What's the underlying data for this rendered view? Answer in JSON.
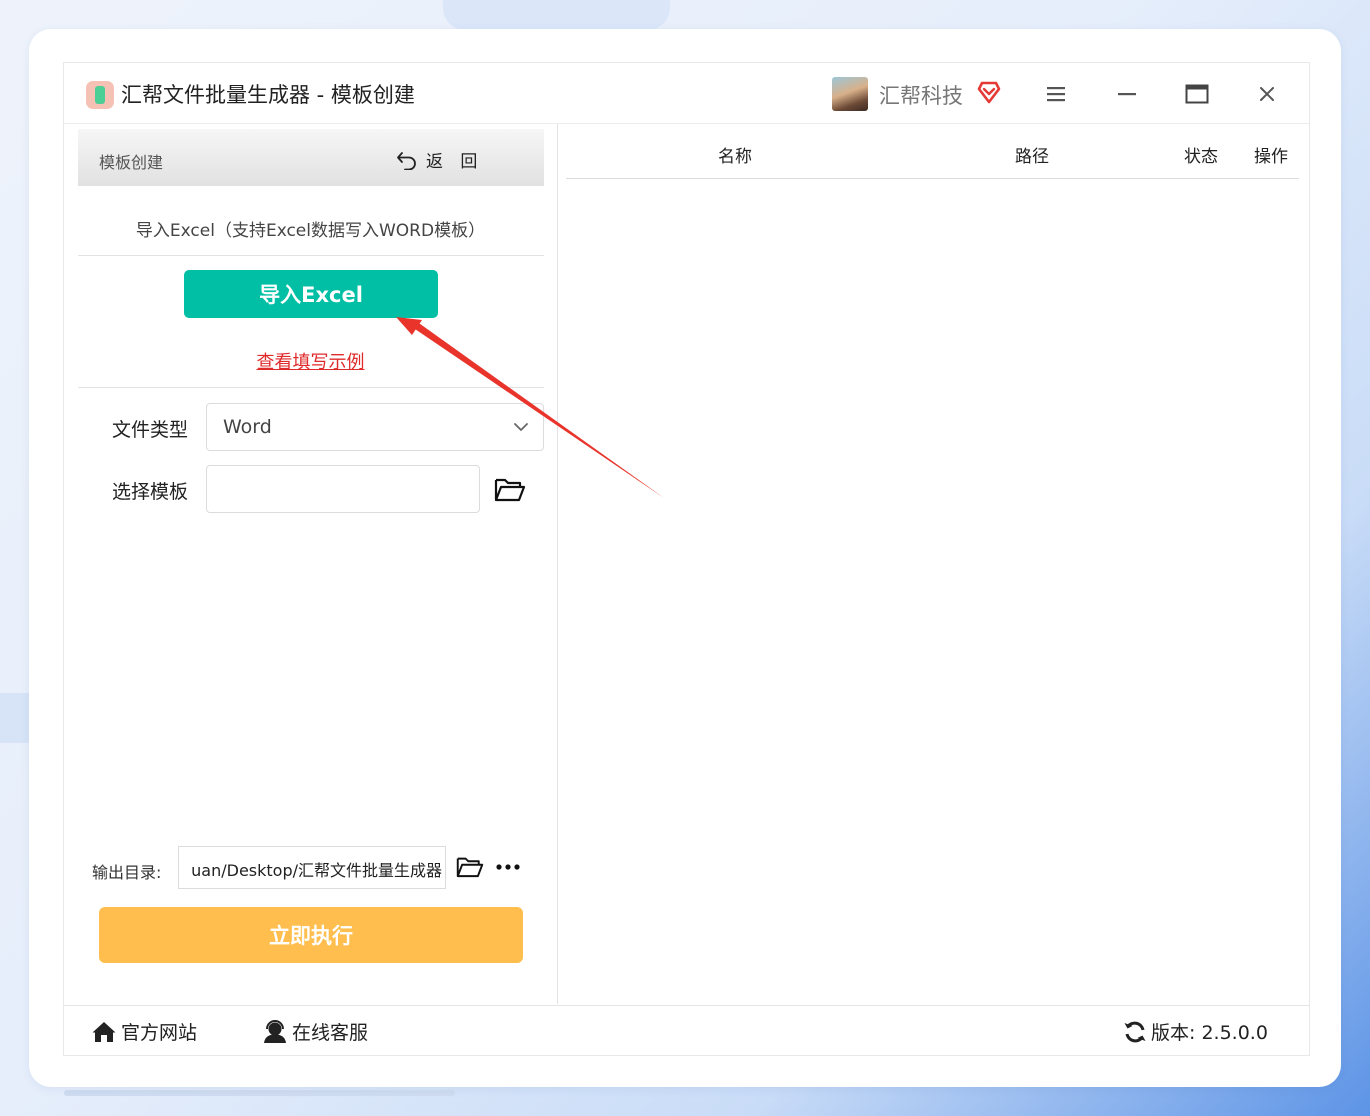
{
  "window": {
    "title": "汇帮文件批量生成器 - 模板创建",
    "brand": "汇帮科技"
  },
  "panel": {
    "title": "模板创建",
    "back_label": "返 回"
  },
  "import": {
    "description": "导入Excel（支持Excel数据写入WORD模板）",
    "button_label": "导入Excel",
    "example_link": "查看填写示例"
  },
  "form": {
    "file_type_label": "文件类型",
    "file_type_value": "Word",
    "template_label": "选择模板",
    "template_value": ""
  },
  "output": {
    "label": "输出目录:",
    "path": "uan/Desktop/汇帮文件批量生成器"
  },
  "run": {
    "label": "立即执行"
  },
  "table": {
    "columns": [
      "名称",
      "路径",
      "状态",
      "操作"
    ]
  },
  "footer": {
    "website": "官方网站",
    "support": "在线客服",
    "version": "版本: 2.5.0.0"
  },
  "colors": {
    "accent": "#00bfa5",
    "run_button": "#ffbe4d",
    "link": "#e02b2b",
    "annotation_arrow": "#e8342b"
  },
  "icons": [
    "app-icon",
    "vip-badge-icon",
    "menu-icon",
    "minimize-icon",
    "maximize-icon",
    "close-icon",
    "undo-icon",
    "chevron-down-icon",
    "folder-icon",
    "more-icon",
    "home-icon",
    "support-icon",
    "refresh-icon"
  ]
}
